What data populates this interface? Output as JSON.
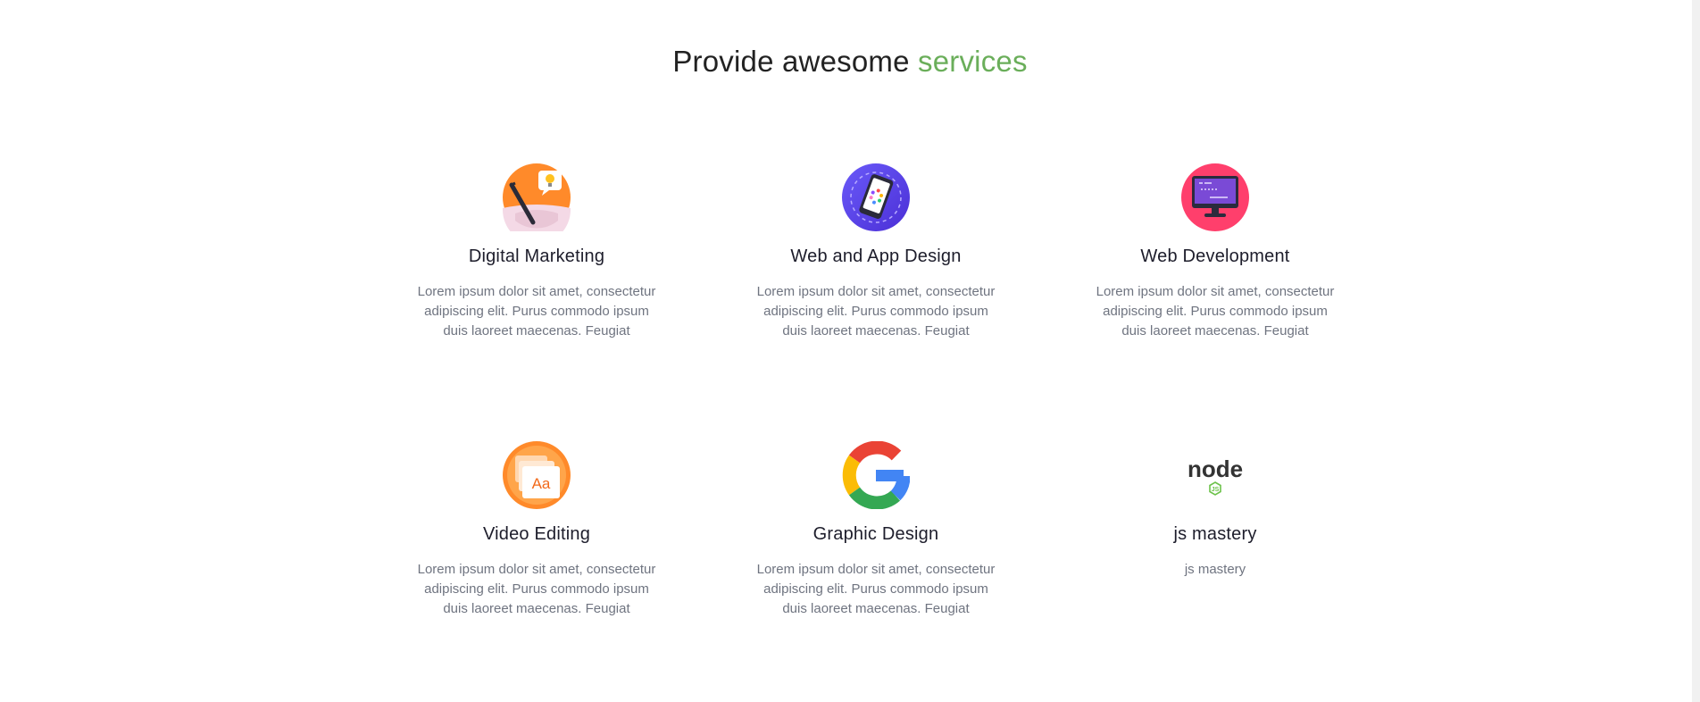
{
  "section": {
    "heading_prefix": "Provide awesome",
    "heading_accent": "services",
    "accent_color": "#6aae5a"
  },
  "services": [
    {
      "title": "Digital Marketing",
      "description": "Lorem ipsum dolor sit amet, consectetur adipiscing elit. Purus commodo ipsum duis laoreet maecenas. Feugiat",
      "icon": "pen-lightbulb-icon"
    },
    {
      "title": "Web and App Design",
      "description": "Lorem ipsum dolor sit amet, consectetur adipiscing elit. Purus commodo ipsum duis laoreet maecenas. Feugiat",
      "icon": "smartphone-icon"
    },
    {
      "title": "Web Development",
      "description": "Lorem ipsum dolor sit amet, consectetur adipiscing elit. Purus commodo ipsum duis laoreet maecenas. Feugiat",
      "icon": "monitor-code-icon"
    },
    {
      "title": "Video Editing",
      "description": "Lorem ipsum dolor sit amet, consectetur adipiscing elit. Purus commodo ipsum duis laoreet maecenas. Feugiat",
      "icon": "font-aa-icon"
    },
    {
      "title": "Graphic Design",
      "description": "Lorem ipsum dolor sit amet, consectetur adipiscing elit. Purus commodo ipsum duis laoreet maecenas. Feugiat",
      "icon": "google-g-icon"
    },
    {
      "title": "js mastery",
      "description": "js mastery",
      "icon": "nodejs-logo-icon",
      "icon_wordmark": "node",
      "icon_badge": "JS"
    }
  ]
}
